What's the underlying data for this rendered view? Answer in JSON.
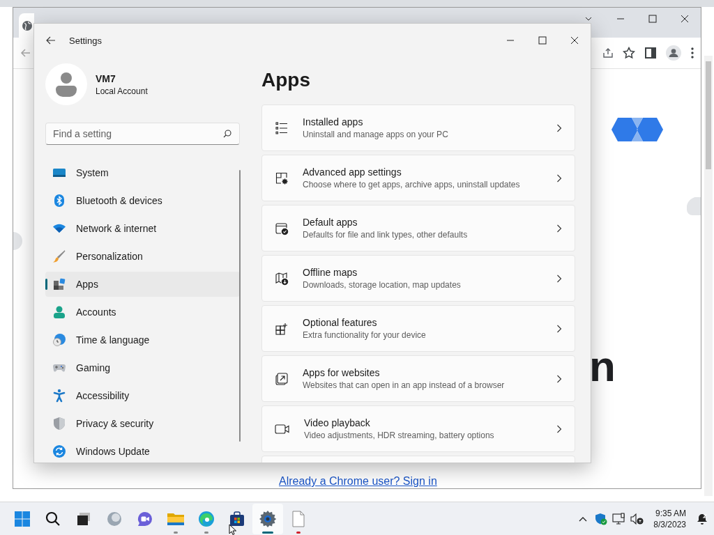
{
  "browser": {
    "heading_fragment": "n",
    "link": "Already a Chrome user? Sign in"
  },
  "settings": {
    "title": "Settings",
    "user": {
      "name": "VM7",
      "account": "Local Account"
    },
    "search": {
      "placeholder": "Find a setting"
    },
    "nav": [
      {
        "label": "System",
        "selected": false
      },
      {
        "label": "Bluetooth & devices",
        "selected": false
      },
      {
        "label": "Network & internet",
        "selected": false
      },
      {
        "label": "Personalization",
        "selected": false
      },
      {
        "label": "Apps",
        "selected": true
      },
      {
        "label": "Accounts",
        "selected": false
      },
      {
        "label": "Time & language",
        "selected": false
      },
      {
        "label": "Gaming",
        "selected": false
      },
      {
        "label": "Accessibility",
        "selected": false
      },
      {
        "label": "Privacy & security",
        "selected": false
      },
      {
        "label": "Windows Update",
        "selected": false
      }
    ],
    "page_title": "Apps",
    "cards": [
      {
        "title": "Installed apps",
        "subtitle": "Uninstall and manage apps on your PC"
      },
      {
        "title": "Advanced app settings",
        "subtitle": "Choose where to get apps, archive apps, uninstall updates"
      },
      {
        "title": "Default apps",
        "subtitle": "Defaults for file and link types, other defaults"
      },
      {
        "title": "Offline maps",
        "subtitle": "Downloads, storage location, map updates"
      },
      {
        "title": "Optional features",
        "subtitle": "Extra functionality for your device"
      },
      {
        "title": "Apps for websites",
        "subtitle": "Websites that can open in an app instead of a browser"
      },
      {
        "title": "Video playback",
        "subtitle": "Video adjustments, HDR streaming, battery options"
      }
    ]
  },
  "taskbar": {
    "apps": [
      {
        "running": false,
        "active": false,
        "attention": false
      },
      {
        "running": false,
        "active": false,
        "attention": false
      },
      {
        "running": false,
        "active": false,
        "attention": false
      },
      {
        "running": true,
        "active": false,
        "attention": false
      },
      {
        "running": true,
        "active": false,
        "attention": false
      },
      {
        "running": false,
        "active": false,
        "attention": false
      },
      {
        "running": true,
        "active": true,
        "attention": false
      },
      {
        "running": true,
        "active": false,
        "attention": true
      }
    ],
    "time": "9:35 AM",
    "date": "8/3/2023"
  }
}
